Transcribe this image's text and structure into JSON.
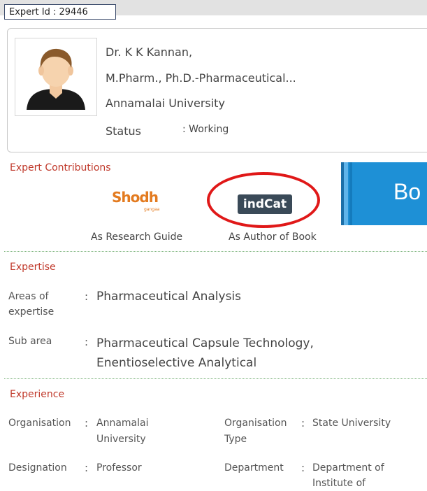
{
  "expert_id": "Expert Id : 29446",
  "profile": {
    "name": "Dr.  K K Kannan,",
    "qualification": "M.Pharm., Ph.D.-Pharmaceutical...",
    "university": "Annamalai University",
    "status_label": "Status",
    "status_value": ": Working"
  },
  "contributions": {
    "title": "Expert Contributions",
    "items": [
      {
        "logo": "Shodh",
        "logo_sub": "gangaa",
        "label": "As Research Guide"
      },
      {
        "logo": "indCat",
        "label": "As Author of Book"
      }
    ],
    "banner_text": "Bo"
  },
  "expertise": {
    "title": "Expertise",
    "areas_label": "Areas of expertise",
    "areas_value": "Pharmaceutical Analysis",
    "sub_label": "Sub area",
    "sub_value_line1": "Pharmaceutical Capsule Technology,",
    "sub_value_line2": "Enentioselective Analytical"
  },
  "experience": {
    "title": "Experience",
    "organisation_label": "Organisation",
    "organisation_value_line1": "Annamalai",
    "organisation_value_line2": "University",
    "org_type_label_line1": "Organisation",
    "org_type_label_line2": "Type",
    "org_type_value": "State University",
    "designation_label": "Designation",
    "designation_value": "Professor",
    "department_label": "Department",
    "department_value_line1": "Department of",
    "department_value_line2": "Institute of"
  },
  "colon": ":",
  "colors": {
    "accent_red": "#c0392b",
    "banner_blue": "#1e90d6",
    "highlight": "#e01818"
  },
  "icons": [
    "avatar-icon",
    "shodhganga-logo",
    "indcat-logo"
  ]
}
